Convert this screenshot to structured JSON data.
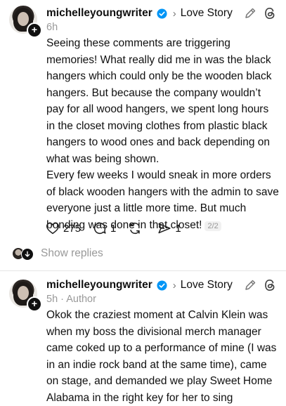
{
  "post1": {
    "username": "michelleyoungwriter",
    "topic": "Love Story",
    "time": "6h",
    "paragraphs": [
      "Seeing these comments are triggering memories! What really did me in was the black hangers which could only be the wooden black hangers. But because the company wouldn’t pay for all wood hangers, we spent long hours in the closet moving clothes from plastic black hangers to wood ones and back depending on what was being shown.",
      "Every few weeks I would sneak in more orders of black wooden hangers with the admin to save everyone just a little more time. But much bonding was done in that closet!"
    ],
    "page_indicator": "2/2",
    "likes": "275",
    "replies": "1",
    "reposts": "",
    "shares": "1"
  },
  "show_replies": {
    "label": "Show replies"
  },
  "post2": {
    "username": "michelleyoungwriter",
    "topic": "Love Story",
    "time_author": "5h · Author",
    "text": "Okok the craziest moment at Calvin Klein was when my boss the divisional merch manager came coked up to a performance of mine (I was in an indie rock band at the same time), came on stage, and demanded we play Sweet Home Alabama in the right key for her to sing"
  },
  "icons": {
    "verified": "verified-badge-icon",
    "chevron": "chevron-right-icon",
    "edit": "pencil-icon",
    "threads": "threads-logo-icon",
    "like": "heart-icon",
    "reply": "comment-icon",
    "repost": "repost-icon",
    "share": "send-icon",
    "plus": "plus-icon"
  },
  "colors": {
    "verified_blue": "#0095f6",
    "muted": "#999999",
    "text": "#101010"
  }
}
